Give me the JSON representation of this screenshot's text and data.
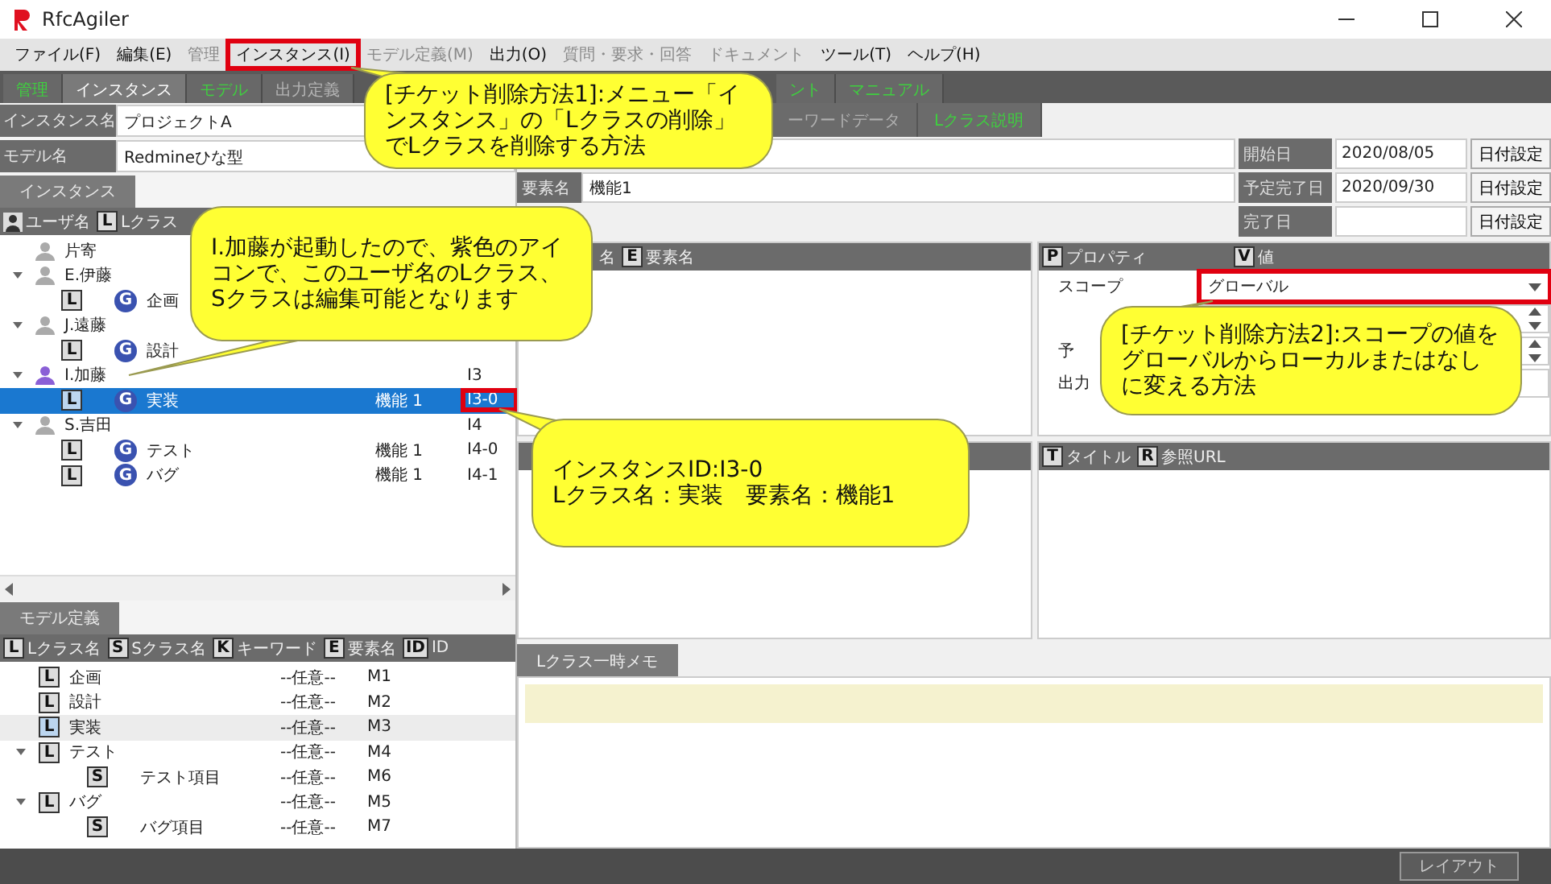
{
  "window": {
    "title": "RfcAgiler"
  },
  "menu": [
    {
      "label": "ファイル(F)",
      "disabled": false,
      "annotated": false
    },
    {
      "label": "編集(E)",
      "disabled": false,
      "annotated": false
    },
    {
      "label": "管理",
      "disabled": true,
      "annotated": false
    },
    {
      "label": "インスタンス(I)",
      "disabled": false,
      "annotated": true
    },
    {
      "label": "モデル定義(M)",
      "disabled": true,
      "annotated": false
    },
    {
      "label": "出力(O)",
      "disabled": false,
      "annotated": false
    },
    {
      "label": "質問・要求・回答",
      "disabled": true,
      "annotated": false
    },
    {
      "label": "ドキュメント",
      "disabled": true,
      "annotated": false
    },
    {
      "label": "ツール(T)",
      "disabled": false,
      "annotated": false
    },
    {
      "label": "ヘルプ(H)",
      "disabled": false,
      "annotated": false
    }
  ],
  "main_tabs": [
    {
      "label": "管理",
      "selected": false,
      "disabled": false
    },
    {
      "label": "インスタンス",
      "selected": true,
      "disabled": false
    },
    {
      "label": "モデル",
      "selected": false,
      "disabled": false
    },
    {
      "label": "出力定義",
      "selected": false,
      "disabled": true
    },
    {
      "label": "ント",
      "selected": false,
      "disabled": false
    },
    {
      "label": "マニュアル",
      "selected": false,
      "disabled": false
    }
  ],
  "instance_panel": {
    "fields": [
      {
        "label": "インスタンス名",
        "value": "プロジェクトA"
      },
      {
        "label": "モデル名",
        "value": "Redmineひな型"
      }
    ],
    "tab": "インスタンス",
    "columns": [
      {
        "kind": "user",
        "label": "ユーザ名"
      },
      {
        "kind": "badge",
        "badge": "L",
        "label": "Lクラス"
      }
    ],
    "tree": [
      {
        "kind": "user",
        "name": "片寄",
        "active": false
      },
      {
        "kind": "user",
        "name": "E.伊藤",
        "active": false,
        "expanded": true,
        "children": [
          {
            "kind": "lclass",
            "badge": "L",
            "group": "G",
            "name": "企画",
            "selected": false
          }
        ]
      },
      {
        "kind": "user",
        "name": "J.遠藤",
        "active": false,
        "expanded": true,
        "children": [
          {
            "kind": "lclass",
            "badge": "L",
            "group": "G",
            "name": "設計",
            "selected": false
          }
        ]
      },
      {
        "kind": "user",
        "name": "I.加藤",
        "active": true,
        "expanded": true,
        "id": "I3",
        "children": [
          {
            "kind": "lclass",
            "badge": "L",
            "group": "G",
            "name": "実装",
            "element": "機能 1",
            "id": "I3-0",
            "selected": true,
            "annotated": true
          }
        ]
      },
      {
        "kind": "user",
        "name": "S.吉田",
        "active": false,
        "expanded": true,
        "id": "I4",
        "children": [
          {
            "kind": "lclass",
            "badge": "L",
            "group": "G",
            "name": "テスト",
            "element": "機能 1",
            "id": "I4-0",
            "selected": false
          },
          {
            "kind": "lclass",
            "badge": "L",
            "group": "G",
            "name": "バグ",
            "element": "機能 1",
            "id": "I4-1",
            "selected": false
          }
        ]
      }
    ]
  },
  "model_panel": {
    "tab": "モデル定義",
    "columns": [
      {
        "badge": "L",
        "label": "Lクラス名"
      },
      {
        "badge": "S",
        "label": "Sクラス名"
      },
      {
        "badge": "K",
        "label": "キーワード"
      },
      {
        "badge": "E",
        "label": "要素名"
      },
      {
        "badge": "ID",
        "label": "ID"
      }
    ],
    "tree": [
      {
        "badge": "L",
        "name": "企画",
        "keyword": "--任意--",
        "id": "M1",
        "selected": false
      },
      {
        "badge": "L",
        "name": "設計",
        "keyword": "--任意--",
        "id": "M2",
        "selected": false
      },
      {
        "badge": "L",
        "name": "実装",
        "keyword": "--任意--",
        "id": "M3",
        "selected": true
      },
      {
        "badge": "L",
        "name": "テスト",
        "keyword": "--任意--",
        "id": "M4",
        "selected": false,
        "expanded": true,
        "children": [
          {
            "badge": "S",
            "name": "テスト項目",
            "keyword": "--任意--",
            "id": "M6",
            "selected": false
          }
        ]
      },
      {
        "badge": "L",
        "name": "バグ",
        "keyword": "--任意--",
        "id": "M5",
        "selected": false,
        "expanded": true,
        "children": [
          {
            "badge": "S",
            "name": "バグ項目",
            "keyword": "--任意--",
            "id": "M7",
            "selected": false
          }
        ]
      }
    ]
  },
  "detail_panel": {
    "tabs": [
      {
        "label": "ーワードデータ",
        "disabled": true
      },
      {
        "label": "Lクラス説明",
        "disabled": false
      }
    ],
    "rows": [
      {
        "kind": "field",
        "date_label": "開始日",
        "date": "2020/08/05",
        "button": "日付設定"
      },
      {
        "kind": "labeled",
        "label": "要素名",
        "value": "機能1",
        "date_label": "予定完了日",
        "date": "2020/09/30",
        "button": "日付設定"
      },
      {
        "kind": "date_only",
        "date_label": "完了日",
        "button": "日付設定"
      }
    ],
    "element_columns": [
      {
        "label": "名"
      },
      {
        "badge": "E",
        "label": "要素名"
      }
    ],
    "property_columns": [
      {
        "badge": "P",
        "label": "プロパティ"
      },
      {
        "badge": "V",
        "label": "値"
      }
    ],
    "properties": [
      {
        "kind": "dropdown",
        "label": "スコープ",
        "value": "グローバル",
        "annotated": true
      },
      {
        "kind": "spinner"
      },
      {
        "kind": "spinner",
        "label": "予"
      },
      {
        "kind": "field",
        "label": "出力"
      }
    ],
    "link_columns": [
      {
        "badge": "T",
        "label": "タイトル"
      },
      {
        "badge": "R",
        "label": "参照URL"
      }
    ],
    "memo_tab": "Lクラス一時メモ"
  },
  "footer": {
    "button": "レイアウト"
  },
  "callouts": [
    "[チケット削除方法1]:メニュー「インスタンス」の「Lクラスの削除」でLクラスを削除する方法",
    "I.加藤が起動したので、紫色のアイコンで、このユーザ名のLクラス、Sクラスは編集可能となります",
    "[チケット削除方法2]:スコープの値をグローバルからローカルまたはなしに変える方法",
    "インスタンスID:I3-0\nLクラス名：実装　要素名：機能1"
  ]
}
